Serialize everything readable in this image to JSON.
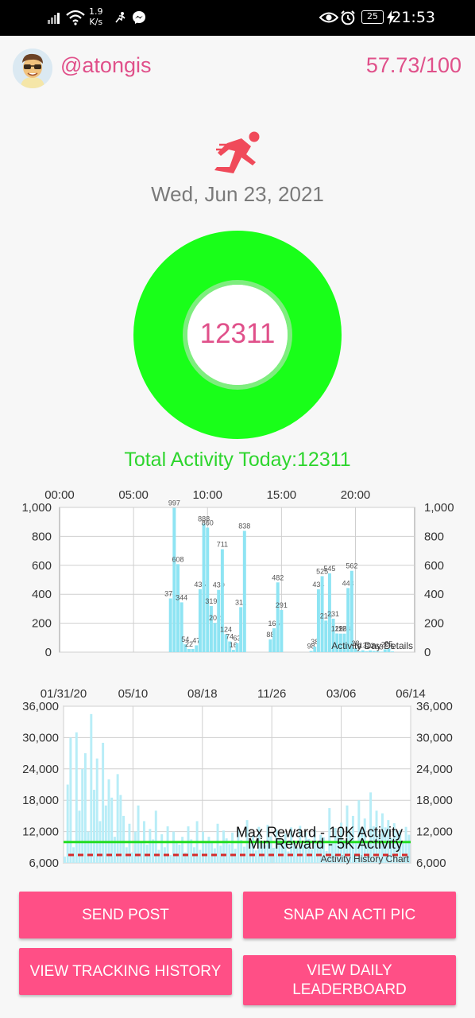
{
  "status_bar": {
    "speed_value": "1.9",
    "speed_unit": "K/s",
    "battery": "25",
    "time": "21:53"
  },
  "header": {
    "username": "@atongis",
    "score": "57.73/100"
  },
  "date": "Wed, Jun 23, 2021",
  "activity": {
    "ring_value": "12311",
    "ring_progress_fraction": 1.0,
    "total_text": "Total Activity Today:12311"
  },
  "colors": {
    "accent_pink": "#ff4f86",
    "text_pink": "#e0508a",
    "ring_green": "#19ff19",
    "total_green": "#2ed52e",
    "bar_cyan": "#8ee4f3",
    "max_line": "#22dd22",
    "min_line": "#d62b2b"
  },
  "icons": {
    "avatar": "avatar-cartoon",
    "runner": "runner-icon",
    "wifi": "wifi-icon",
    "messenger": "messenger-icon",
    "eye": "eye-icon",
    "alarm": "alarm-icon"
  },
  "chart_data": [
    {
      "type": "bar",
      "title": "Activity Day Details",
      "x_unit": "hours",
      "x_ticks": [
        "00:00",
        "05:00",
        "10:00",
        "15:00",
        "20:00"
      ],
      "x_tick_values": [
        0,
        5,
        10,
        15,
        20
      ],
      "xlim": [
        0,
        24
      ],
      "y_ticks": [
        "0",
        "200",
        "400",
        "600",
        "800",
        "1,000"
      ],
      "y_tick_values": [
        0,
        200,
        400,
        600,
        800,
        1000
      ],
      "ylim": [
        0,
        1000
      ],
      "grid": true,
      "x": [
        7.5,
        7.75,
        8.0,
        8.25,
        8.5,
        8.75,
        9.0,
        9.25,
        9.5,
        9.75,
        10.0,
        10.25,
        10.5,
        10.75,
        11.0,
        11.25,
        11.5,
        11.75,
        12.0,
        12.25,
        12.5,
        12.75,
        13.0,
        13.25,
        13.5,
        13.75,
        14.0,
        14.25,
        14.5,
        14.75,
        15.0,
        15.25,
        15.5,
        15.75,
        16.0,
        16.25,
        16.5,
        16.75,
        17.0,
        17.25,
        17.5,
        17.75,
        18.0,
        18.25,
        18.5,
        18.75,
        19.0,
        19.25,
        19.5,
        19.75,
        20.0,
        20.25,
        20.5,
        20.75,
        21.0,
        21.25,
        21.5,
        21.75,
        22.0,
        22.25,
        22.5
      ],
      "values": [
        371,
        997,
        608,
        344,
        54,
        22,
        22,
        47,
        435,
        888,
        860,
        319,
        202,
        430,
        711,
        124,
        74,
        16,
        63,
        311,
        838,
        0,
        0,
        0,
        0,
        0,
        0,
        88,
        165,
        482,
        291,
        0,
        0,
        0,
        0,
        0,
        0,
        0,
        8,
        38,
        434,
        525,
        218,
        545,
        231,
        129,
        128,
        128,
        443,
        562,
        28,
        6,
        13,
        6,
        12,
        8,
        6,
        3,
        20,
        25,
        5
      ],
      "labels": [
        "371",
        "997",
        "608",
        "344",
        "54",
        "22",
        "",
        "47",
        "435",
        "888",
        "860",
        "319",
        "202",
        "430",
        "711",
        "124",
        "74",
        "16",
        "63",
        "311",
        "838",
        "",
        "",
        "",
        "",
        "",
        "",
        "88",
        "165",
        "482",
        "291",
        "",
        "",
        "",
        "",
        "",
        "",
        "",
        "98",
        "38",
        "434",
        "525",
        "218",
        "545",
        "231",
        "129",
        "128",
        "128",
        "443",
        "562",
        "28",
        "6",
        "13",
        "6",
        "12",
        "8",
        "6",
        "3",
        "20",
        "25",
        "5"
      ]
    },
    {
      "type": "bar",
      "title": "Activity History Chart",
      "x_ticks": [
        "01/31/20",
        "05/10",
        "08/18",
        "11/26",
        "03/06",
        "06/14"
      ],
      "y_ticks": [
        "6,000",
        "12,000",
        "18,000",
        "24,000",
        "30,000",
        "36,000"
      ],
      "y_tick_values": [
        6000,
        12000,
        18000,
        24000,
        30000,
        36000
      ],
      "ylim": [
        6000,
        36000
      ],
      "grid": true,
      "start_date": "2020-01-31",
      "end_date": "2021-06-23",
      "values": [
        7200,
        21000,
        30000,
        9000,
        31000,
        16000,
        24000,
        27000,
        12000,
        34500,
        20000,
        26000,
        14000,
        29000,
        17000,
        22000,
        18500,
        11000,
        23000,
        19000,
        15000,
        9000,
        13500,
        8000,
        12000,
        17000,
        10000,
        14000,
        9500,
        12500,
        10500,
        16000,
        8500,
        11500,
        9000,
        13000,
        7500,
        12000,
        10000,
        9500,
        11000,
        8000,
        13000,
        10500,
        9000,
        14000,
        8500,
        12000,
        9800,
        11000,
        10200,
        8800,
        13500,
        9300,
        12200,
        10700,
        9600,
        11800,
        8700,
        12600,
        10400,
        9100,
        14200,
        9900,
        11300,
        8400,
        12900,
        10100,
        9400,
        13300,
        11100,
        8900,
        12400,
        10800,
        9700,
        11600,
        8200,
        12800,
        10300,
        9000,
        13100,
        9500,
        11900,
        10600,
        8600,
        12300,
        9200,
        11400,
        10900,
        8300,
        16500,
        9800,
        12700,
        11200,
        13700,
        10400,
        17000,
        12100,
        15000,
        9900,
        18000,
        12500,
        14500,
        10200,
        19500,
        13000,
        16000,
        11500,
        15500,
        12800,
        14200,
        10800,
        13600,
        11900,
        12300,
        10100,
        12900,
        11400
      ],
      "reference_lines": [
        {
          "name": "Max Reward - 10K Activity",
          "value": 10000
        },
        {
          "name": "Min Reward - 5K Activity",
          "value": 5000
        }
      ]
    }
  ],
  "buttons": {
    "send_post": "SEND POST",
    "snap_pic": "SNAP AN ACTI PIC",
    "view_history": "VIEW TRACKING HISTORY",
    "leaderboard_line1": "VIEW DAILY",
    "leaderboard_line2": "LEADERBOARD"
  }
}
